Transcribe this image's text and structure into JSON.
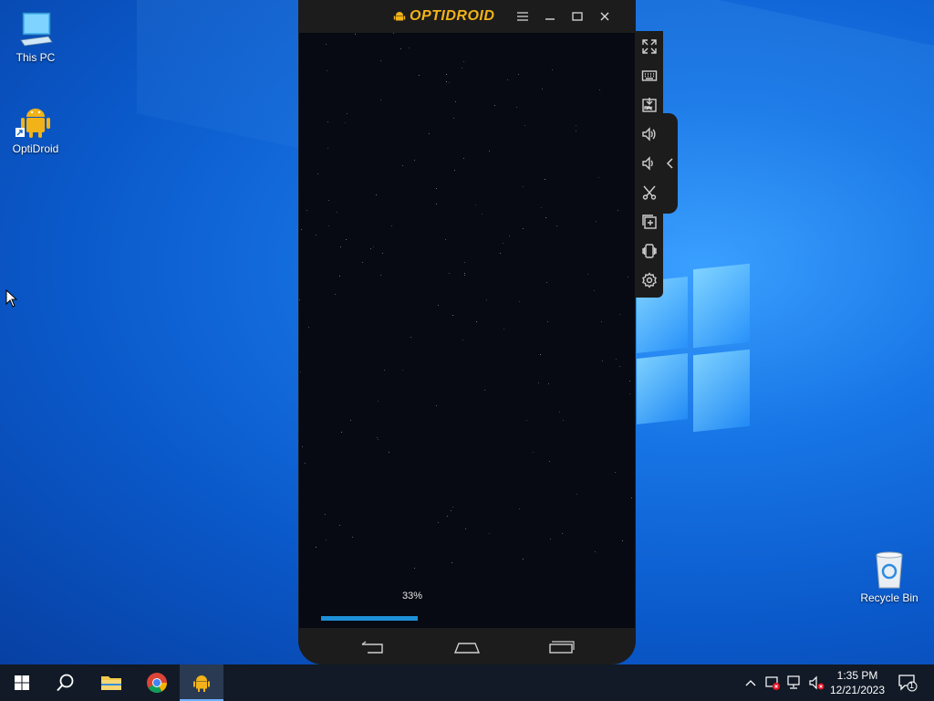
{
  "desktop": {
    "icons": [
      {
        "label": "This PC",
        "icon": "computer-icon"
      },
      {
        "label": "OptiDroid",
        "icon": "android-icon"
      },
      {
        "label": "Recycle Bin",
        "icon": "recycle-bin-icon"
      }
    ]
  },
  "emulator": {
    "brand": "OPTIDROID",
    "title_buttons": [
      "menu-icon",
      "minimize-icon",
      "maximize-icon",
      "close-icon"
    ],
    "loading": {
      "percent_label": "33%",
      "progress": 0.33
    },
    "toolbar": [
      "fullscreen-icon",
      "keyboard-icon",
      "apk-install-icon",
      "volume-up-icon",
      "volume-down-icon",
      "screenshot-scissors-icon",
      "multi-instance-icon",
      "shake-icon",
      "settings-gear-icon"
    ],
    "nav": [
      "back-icon",
      "home-icon",
      "recent-apps-icon"
    ],
    "accent": "#f2b318",
    "progress_color": "#1e8fd6"
  },
  "taskbar": {
    "apps": [
      "start-icon",
      "search-icon",
      "file-explorer-icon",
      "chrome-icon",
      "optidroid-icon"
    ],
    "tray": [
      "chevron-up-icon",
      "security-icon",
      "network-icon",
      "volume-muted-icon"
    ],
    "time": "1:35 PM",
    "date": "12/21/2023",
    "notifications_count": "1"
  }
}
